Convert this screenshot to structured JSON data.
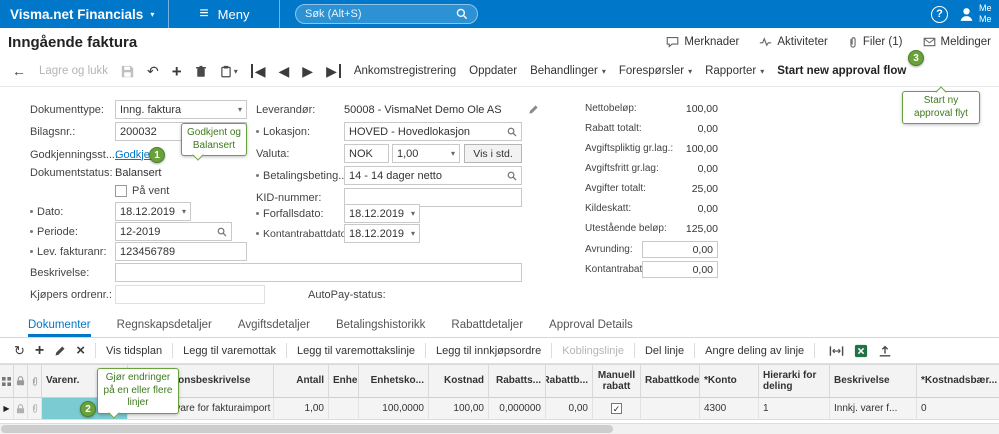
{
  "colors": {
    "accent_blue": "#0077c8",
    "annotation_green": "#69a23b",
    "highlight_teal": "#7bccd2"
  },
  "topbar": {
    "brand": "Visma.net Financials",
    "menu_label": "Meny",
    "search_placeholder": "Søk (Alt+S)",
    "help_label": "?",
    "user_line1": "Me",
    "user_line2": "Me"
  },
  "header": {
    "title": "Inngående faktura",
    "actions": [
      {
        "label": "Merknader"
      },
      {
        "label": "Aktiviteter"
      },
      {
        "label": "Filer (1)"
      },
      {
        "label": "Meldinger"
      }
    ]
  },
  "toolbar": {
    "save_and_close": "Lagre og lukk",
    "buttons": [
      "Ankomstregistrering",
      "Oppdater",
      "Behandlinger",
      "Forespørsler",
      "Rapporter",
      "Start new approval flow"
    ]
  },
  "form": {
    "left": {
      "dokumenttype_label": "Dokumenttype:",
      "dokumenttype_value": "Inng. faktura",
      "bilagsnr_label": "Bilagsnr.:",
      "bilagsnr_value": "200032",
      "godkjenning_label": "Godkjenningsst...:",
      "godkjenning_value": "Godkjent",
      "dokumentstatus_label": "Dokumentstatus:",
      "dokumentstatus_value": "Balansert",
      "pa_vent_label": "På vent",
      "dato_label": "Dato:",
      "dato_value": "18.12.2019",
      "periode_label": "Periode:",
      "periode_value": "12-2019",
      "lev_fakturanr_label": "Lev. fakturanr:",
      "lev_fakturanr_value": "123456789",
      "beskrivelse_label": "Beskrivelse:",
      "beskrivelse_value": "",
      "kjopers_ordrenr_label": "Kjøpers ordrenr.:",
      "kjopers_ordrenr_value": "",
      "autopay_label": "AutoPay-status:"
    },
    "middle": {
      "leverandor_label": "Leverandør:",
      "leverandor_value": "50008 - VismaNet Demo Ole AS",
      "lokasjon_label": "Lokasjon:",
      "lokasjon_value": "HOVED - Hovedlokasjon",
      "valuta_label": "Valuta:",
      "valuta_code": "NOK",
      "valuta_rate": "1,00",
      "vis_i_std": "Vis i std.",
      "betaling_label": "Betalingsbeting...:",
      "betaling_value": "14 - 14 dager netto",
      "kid_label": "KID-nummer:",
      "kid_value": "",
      "forfallsdato_label": "Forfallsdato:",
      "forfallsdato_value": "18.12.2019",
      "kontantrabattdato_label": "Kontantrabattdato:",
      "kontantrabattdato_value": "18.12.2019"
    },
    "totals": {
      "rows": [
        {
          "label": "Nettobeløp:",
          "value": "100,00"
        },
        {
          "label": "Rabatt totalt:",
          "value": "0,00"
        },
        {
          "label": "Avgiftspliktig gr.lag.:",
          "value": "100,00"
        },
        {
          "label": "Avgiftsfritt gr.lag:",
          "value": "0,00"
        },
        {
          "label": "Avgifter totalt:",
          "value": "25,00"
        },
        {
          "label": "Kildeskatt:",
          "value": "0,00"
        },
        {
          "label": "Utestående beløp:",
          "value": "125,00"
        },
        {
          "label": "Avrunding:",
          "value": "0,00"
        },
        {
          "label": "Kontantrabatt:",
          "value": "0,00"
        }
      ]
    }
  },
  "tabs": [
    "Dokumenter",
    "Regnskapsdetaljer",
    "Avgiftsdetaljer",
    "Betalingshistorikk",
    "Rabattdetaljer",
    "Approval Details"
  ],
  "grid_toolbar": {
    "buttons": [
      "Vis tidsplan",
      "Legg til varemottak",
      "Legg til varemottakslinje",
      "Legg til innkjøpsordre",
      "Koblingslinje",
      "Del linje",
      "Angre deling av linje"
    ]
  },
  "grid": {
    "columns": [
      "Varenr.",
      "Transaksjonsbeskrivelse",
      "Antall",
      "Enhe",
      "Enhetsko...",
      "Kostnad",
      "Rabatts...",
      "Rabattb...",
      "Manuell rabatt",
      "Rabattkode",
      "*Konto",
      "Hierarki for deling",
      "Beskrivelse",
      "*Kostnadsbær..."
    ],
    "row": {
      "varenr": "",
      "transaksjonsbeskrivelse": "Standard vare for fakturaimport ...",
      "antall": "1,00",
      "enhet": "",
      "enhetskostnad": "100,0000",
      "kostnad": "100,00",
      "rabattsats": "0,000000",
      "rabattbelop": "0,00",
      "manuell_rabatt": true,
      "rabattkode": "",
      "konto": "4300",
      "hierarki_for_deling": "1",
      "beskrivelse": "Innkj. varer f...",
      "kostnadsbaerer": "0"
    }
  },
  "annotations": {
    "step1": {
      "number": "1",
      "text": "Godkjent og Balansert"
    },
    "step2": {
      "number": "2",
      "text": "Gjør endringer på en eller flere linjer"
    },
    "step3": {
      "number": "3",
      "text": "Start ny approval flyt"
    }
  }
}
